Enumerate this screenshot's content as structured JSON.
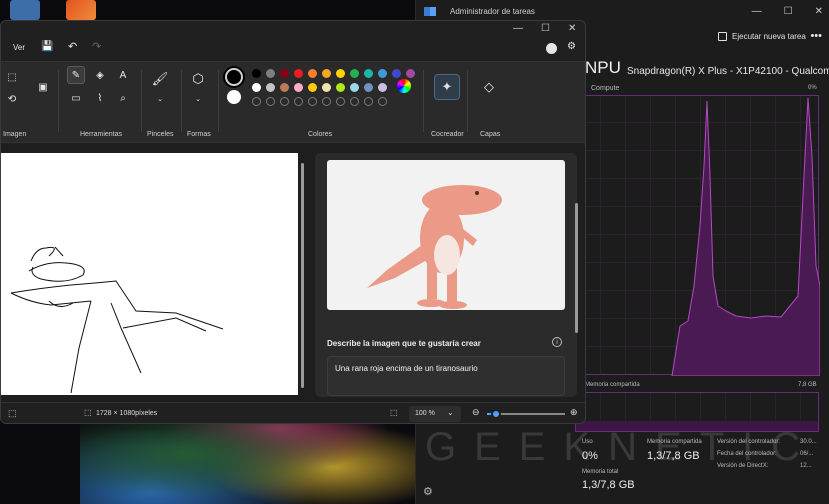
{
  "task_manager": {
    "title": "Administrador de tareas",
    "run_task_label": "Ejecutar nueva tarea",
    "more_label": "•••",
    "heading": "NPU",
    "device_name": "Snapdragon(R) X Plus - X1P42100 - Qualcom...",
    "compute_label": "Compute",
    "compute_max": "0%",
    "shared_memory_label": "Memoria compartida",
    "shared_memory_value": "7,8 GB",
    "stats": {
      "usage_label": "Uso",
      "usage_value": "0%",
      "shared_label": "Memoria compartida",
      "shared_value": "1,3/7,8 GB",
      "total_label": "Memoria total",
      "total_value": "1,3/7,8 GB",
      "driver_version_label": "Versión del controlador:",
      "driver_version_value": "30.0...",
      "driver_date_label": "Fecha del controlador:",
      "driver_date_value": "06/...",
      "directx_label": "Versión de DirectX:",
      "directx_value": "12..."
    },
    "watermark": "GEEKNETIC"
  },
  "paint": {
    "menu": {
      "view_label": "Ver"
    },
    "window_buttons": {
      "minimize": "—",
      "maximize": "☐",
      "close": "✕"
    },
    "ribbon": {
      "groups": {
        "image": "Imagen",
        "tools": "Herramientas",
        "brushes": "Pinceles",
        "shapes": "Formas",
        "colors": "Colores",
        "cocreator": "Cocreador",
        "layers": "Capas"
      },
      "palette_row1": [
        "#000000",
        "#7f7f7f",
        "#880015",
        "#ed1c24",
        "#ff7f27",
        "#f5a623",
        "#ffd400",
        "#22b14c",
        "#19b8a6",
        "#3f9ad6",
        "#3f48cc",
        "#a349a4"
      ],
      "palette_row2": [
        "#ffffff",
        "#c3c3c3",
        "#b97a57",
        "#ffaec9",
        "#ffc90e",
        "#efe4b0",
        "#b5e61d",
        "#99d9ea",
        "#7092be",
        "#c8bfe7"
      ]
    },
    "cocreator": {
      "prompt_label": "Describe la imagen que te gustaría crear",
      "prompt_value": "Una rana roja  encima de un tiranosaurio",
      "info_icon": "i"
    },
    "status": {
      "dimensions": "1728 × 1080píxeles",
      "zoom": "100 %",
      "zoom_fraction": 0.12
    }
  }
}
